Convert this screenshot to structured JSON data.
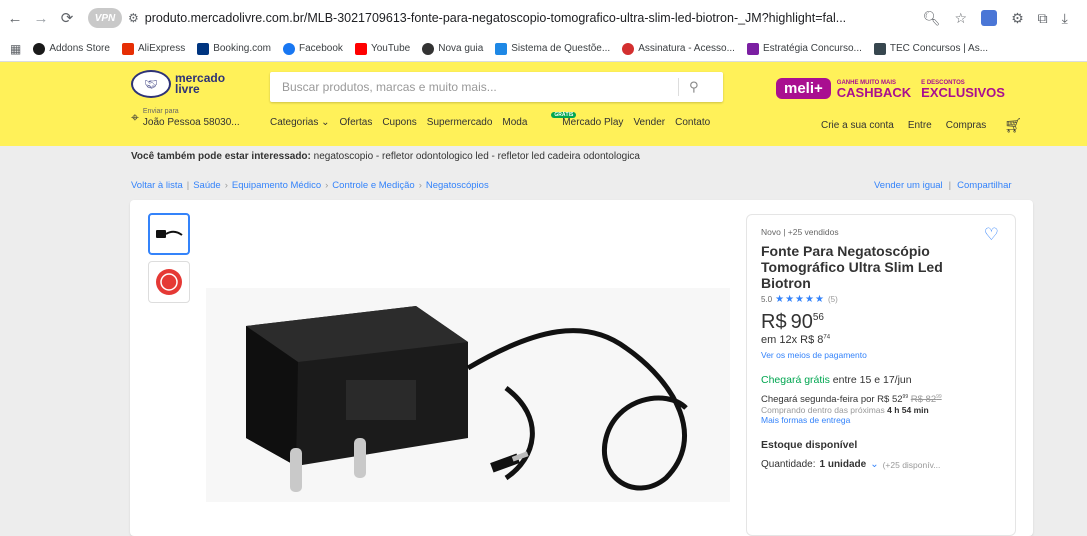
{
  "browser": {
    "vpn_label": "VPN",
    "url": "produto.mercadolivre.com.br/MLB-3021709613-fonte-para-negatoscopio-tomografico-ultra-slim-led-biotron-_JM?highlight=fal...",
    "bookmarks": [
      {
        "label": "Addons Store",
        "color": "#1a1a1a"
      },
      {
        "label": "AliExpress",
        "color": "#e62e04"
      },
      {
        "label": "Booking.com",
        "color": "#003580"
      },
      {
        "label": "Facebook",
        "color": "#1877f2"
      },
      {
        "label": "YouTube",
        "color": "#ff0000"
      },
      {
        "label": "Nova guia",
        "color": "#333333"
      },
      {
        "label": "Sistema de Questõe...",
        "color": "#1e88e5"
      },
      {
        "label": "Assinatura - Acesso...",
        "color": "#d32f2f"
      },
      {
        "label": "Estratégia Concurso...",
        "color": "#7b1fa2"
      },
      {
        "label": "TEC Concursos | As...",
        "color": "#37474f"
      }
    ]
  },
  "header": {
    "logo_line1": "mercado",
    "logo_line2": "livre",
    "search_placeholder": "Buscar produtos, marcas e muito mais...",
    "meli_label": "meli+",
    "meli_small1": "GANHE MUITO MAIS",
    "meli_big1": "CASHBACK",
    "meli_small2": "E DESCONTOS",
    "meli_big2": "EXCLUSIVOS",
    "loc_small": "Enviar para",
    "loc_big": "João Pessoa 58030...",
    "categories": [
      "Categorias ⌄",
      "Ofertas",
      "Cupons",
      "Supermercado",
      "Moda",
      "Mercado Play",
      "Vender",
      "Contato"
    ],
    "new_badge": "GRÁTIS",
    "account": [
      "Crie a sua conta",
      "Entre",
      "Compras"
    ]
  },
  "page": {
    "interest_label": "Você também pode estar interessado:",
    "interest_items": "negatoscopio - refletor odontologico led - refletor led cadeira odontologica",
    "back": "Voltar à lista",
    "breadcrumbs": [
      "Saúde",
      "Equipamento Médico",
      "Controle e Medição",
      "Negatoscópios"
    ],
    "sell_same": "Vender um igual",
    "share": "Compartilhar"
  },
  "product": {
    "condition": "Novo  |  +25 vendidos",
    "title": "Fonte Para Negatoscópio Tomográfico Ultra Slim Led Biotron",
    "rating_value": "5.0",
    "stars": "★★★★★",
    "rating_count": "(5)",
    "currency": "R$",
    "price_int": "90",
    "price_cents": "56",
    "installments_prefix": "em 12x R$ 8",
    "installments_cents": "74",
    "pay_link": "Ver os meios de pagamento",
    "ship_free": "Chegará grátis",
    "ship_free_rest": " entre 15 e 17/jun",
    "ship2_prefix": "Chegará segunda-feira por R$ 52",
    "ship2_cents": "99",
    "ship2_old": "R$ 82",
    "ship2_old_cents": "99",
    "ship3_prefix": "Comprando dentro das próximas ",
    "ship3_time": "4 h 54 min",
    "ship_link": "Mais formas de entrega",
    "stock": "Estoque disponível",
    "qty_label": "Quantidade:",
    "qty_value": "1 unidade",
    "qty_avail": "(+25 disponív..."
  }
}
